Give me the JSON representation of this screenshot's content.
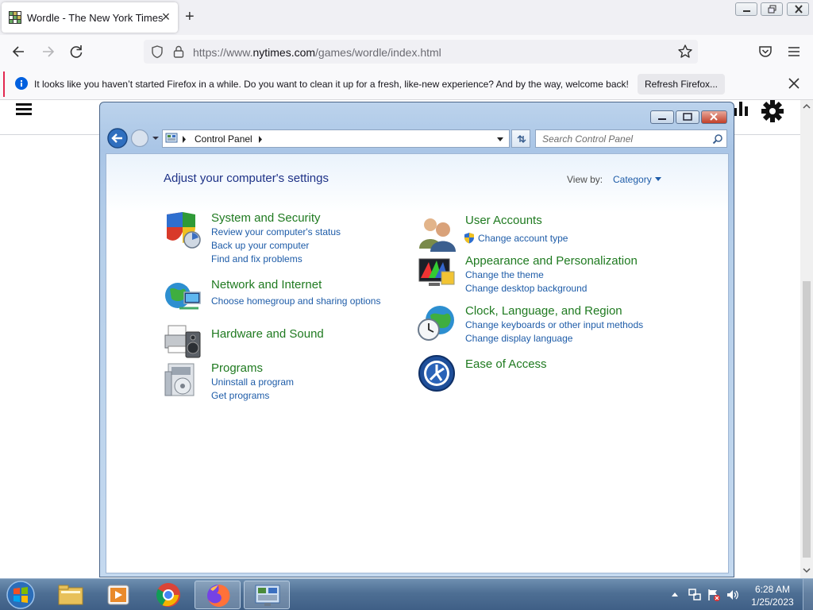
{
  "browser": {
    "tab_title": "Wordle - The New York Times",
    "url_prefix": "https://www.",
    "url_domain": "nytimes.com",
    "url_path": "/games/wordle/index.html",
    "notification": "It looks like you haven’t started Firefox in a while. Do you want to clean it up for a fresh, like-new experience? And by the way, welcome back!",
    "notification_button": "Refresh Firefox..."
  },
  "control_panel": {
    "breadcrumb": "Control Panel",
    "search_placeholder": "Search Control Panel",
    "heading": "Adjust your computer's settings",
    "view_by_label": "View by:",
    "view_by_value": "Category",
    "categories_left": [
      {
        "title": "System and Security",
        "links": [
          "Review your computer's status",
          "Back up your computer",
          "Find and fix problems"
        ]
      },
      {
        "title": "Network and Internet",
        "links": [
          "Choose homegroup and sharing options"
        ]
      },
      {
        "title": "Hardware and Sound",
        "links": []
      },
      {
        "title": "Programs",
        "links": [
          "Uninstall a program",
          "Get programs"
        ]
      }
    ],
    "categories_right": [
      {
        "title": "User Accounts",
        "links": [
          "Change account type"
        ]
      },
      {
        "title": "Appearance and Personalization",
        "links": [
          "Change the theme",
          "Change desktop background"
        ]
      },
      {
        "title": "Clock, Language, and Region",
        "links": [
          "Change keyboards or other input methods",
          "Change display language"
        ]
      },
      {
        "title": "Ease of Access",
        "links": []
      }
    ]
  },
  "taskbar": {
    "time": "6:28 AM",
    "date": "1/25/2023"
  }
}
